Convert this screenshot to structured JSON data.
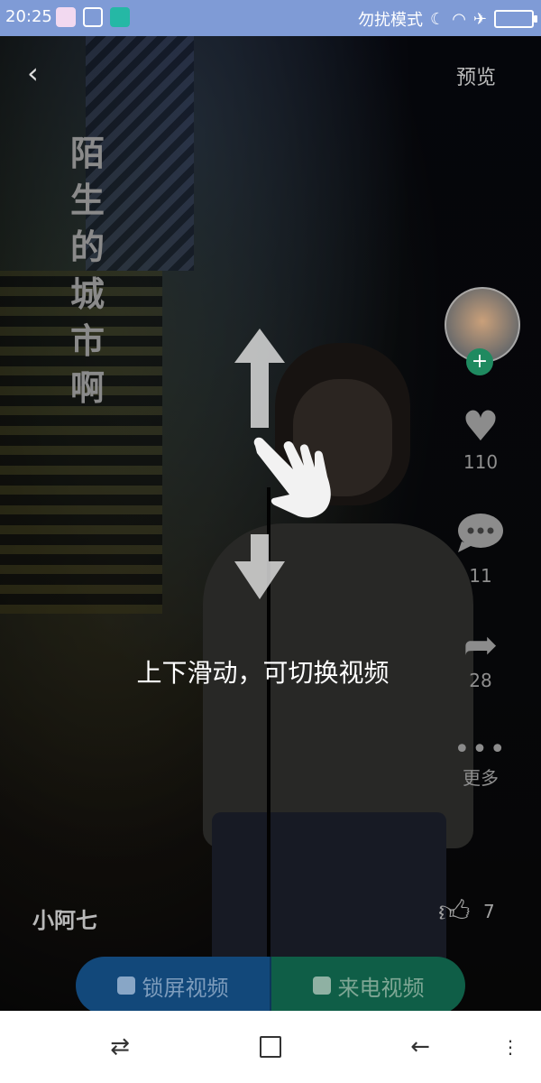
{
  "status_bar": {
    "time": "20:25",
    "dnd_text": "勿扰模式",
    "icons": [
      "moon-icon",
      "wifi-icon",
      "airplane-icon",
      "battery-icon"
    ]
  },
  "header": {
    "back_icon": "chevron-left-icon",
    "preview_label": "预览"
  },
  "video": {
    "vertical_title": "陌生的城市啊",
    "author": "小阿七",
    "hint_text": "上下滑动，可切换视频"
  },
  "side_actions": {
    "like_count": "110",
    "comment_count": "11",
    "share_count": "28",
    "more_label": "更多"
  },
  "bottom_like_count": "7",
  "bottom_buttons": {
    "lock_video": "锁屏视频",
    "call_video": "来电视频"
  },
  "colors": {
    "status_bar": "#7f9bd6",
    "lock_button": "#12487a",
    "call_button": "#0f5e47",
    "follow_plus": "#1f8a60"
  }
}
